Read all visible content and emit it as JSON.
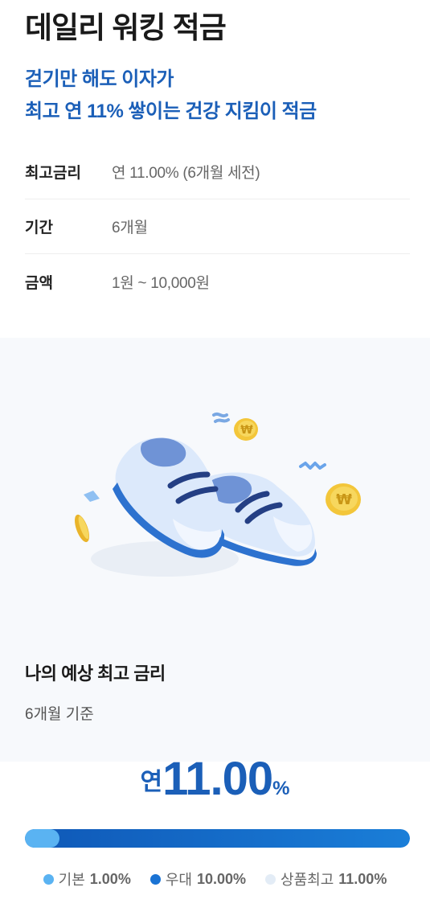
{
  "header": {
    "title": "데일리 워킹 적금",
    "subtitle_line1": "걷기만 해도 이자가",
    "subtitle_line2": "최고 연 11% 쌓이는 건강 지킴이 적금"
  },
  "info": [
    {
      "label": "최고금리",
      "value": "연 11.00% (6개월 세전)"
    },
    {
      "label": "기간",
      "value": "6개월"
    },
    {
      "label": "금액",
      "value": "1원 ~ 10,000원"
    }
  ],
  "illustration": {
    "icon": "sneakers-with-coins-illustration"
  },
  "rate_section": {
    "title": "나의 예상 최고 금리",
    "subtitle": "6개월 기준",
    "prefix": "연",
    "value": "11.00",
    "unit": "%"
  },
  "rate_bar": {
    "base_fraction": 0.09,
    "preferential_fraction": 1.0,
    "colors": {
      "base": "#5ab3f2",
      "preferential": "#1a73d4",
      "max": "#e3ecf6"
    }
  },
  "legend": [
    {
      "label": "기본",
      "value": "1.00%",
      "color": "#5ab3f2"
    },
    {
      "label": "우대",
      "value": "10.00%",
      "color": "#1a73d4"
    },
    {
      "label": "상품최고",
      "value": "11.00%",
      "color": "#e3ecf6"
    }
  ]
}
